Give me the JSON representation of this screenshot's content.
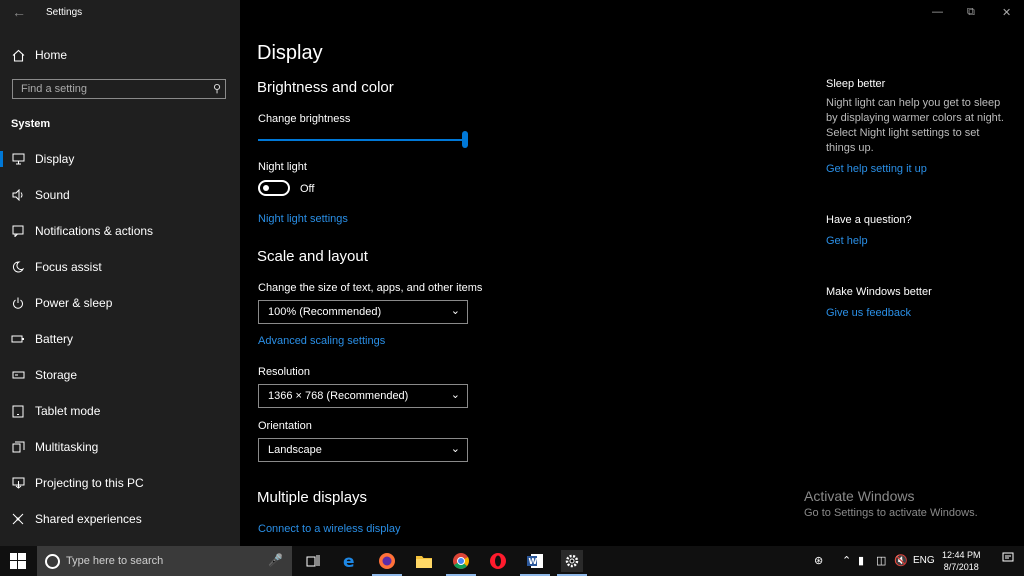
{
  "window": {
    "title": "Settings",
    "back_icon": "back-arrow-icon"
  },
  "sidebar": {
    "home_label": "Home",
    "search_placeholder": "Find a setting",
    "section": "System",
    "items": [
      {
        "label": "Display",
        "icon": "monitor-icon",
        "active": true
      },
      {
        "label": "Sound",
        "icon": "speaker-icon"
      },
      {
        "label": "Notifications & actions",
        "icon": "notification-icon"
      },
      {
        "label": "Focus assist",
        "icon": "moon-icon"
      },
      {
        "label": "Power & sleep",
        "icon": "power-icon"
      },
      {
        "label": "Battery",
        "icon": "battery-icon"
      },
      {
        "label": "Storage",
        "icon": "storage-icon"
      },
      {
        "label": "Tablet mode",
        "icon": "tablet-icon"
      },
      {
        "label": "Multitasking",
        "icon": "multitasking-icon"
      },
      {
        "label": "Projecting to this PC",
        "icon": "projecting-icon"
      },
      {
        "label": "Shared experiences",
        "icon": "shared-icon"
      }
    ]
  },
  "main": {
    "title": "Display",
    "brightness": {
      "heading": "Brightness and color",
      "label": "Change brightness",
      "value": 1.0
    },
    "night_light": {
      "label": "Night light",
      "state": "Off",
      "settings_link": "Night light settings"
    },
    "scale": {
      "heading": "Scale and layout",
      "size_label": "Change the size of text, apps, and other items",
      "size_value": "100% (Recommended)",
      "advanced_link": "Advanced scaling settings",
      "resolution_label": "Resolution",
      "resolution_value": "1366 × 768 (Recommended)",
      "orientation_label": "Orientation",
      "orientation_value": "Landscape"
    },
    "multiple": {
      "heading": "Multiple displays",
      "link": "Connect to a wireless display"
    }
  },
  "aside": {
    "sleep_heading": "Sleep better",
    "sleep_text": "Night light can help you get to sleep by displaying warmer colors at night. Select Night light settings to set things up.",
    "sleep_link": "Get help setting it up",
    "question_heading": "Have a question?",
    "question_link": "Get help",
    "better_heading": "Make Windows better",
    "better_link": "Give us feedback"
  },
  "watermark": {
    "line1": "Activate Windows",
    "line2": "Go to Settings to activate Windows."
  },
  "taskbar": {
    "search_placeholder": "Type here to search",
    "apps": [
      "task-view-icon",
      "edge-icon",
      "firefox-icon",
      "file-explorer-icon",
      "chrome-icon",
      "opera-icon",
      "word-icon",
      "settings-gear-icon"
    ],
    "language": "ENG",
    "time": "12:44 PM",
    "date": "8/7/2018"
  },
  "colors": {
    "accent": "#0078d7",
    "link": "#2a8fe6",
    "sidebar_bg": "#1f1f1f",
    "main_bg": "#000000"
  }
}
